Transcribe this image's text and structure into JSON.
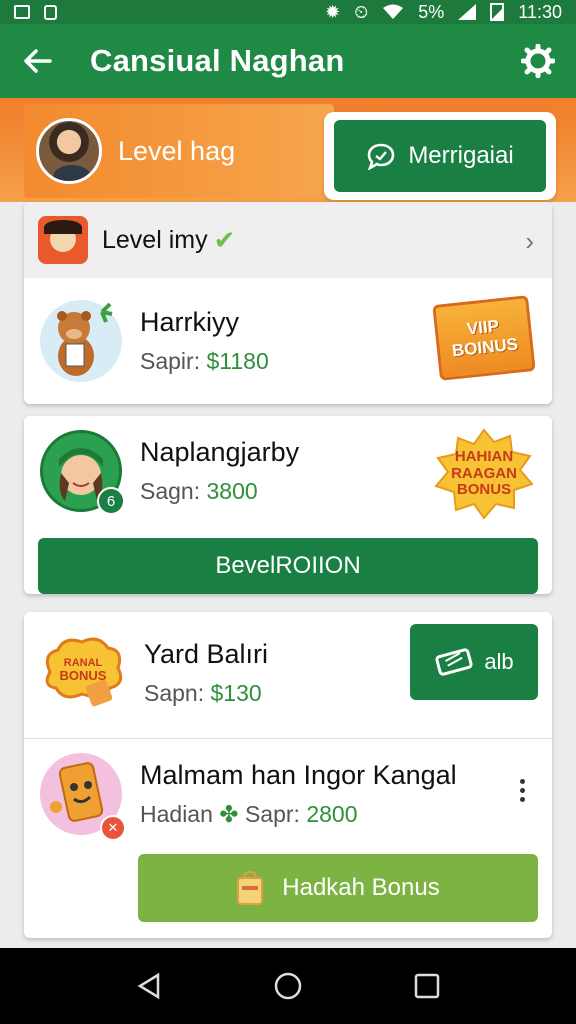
{
  "status_bar": {
    "battery": "5%",
    "time": "11:30"
  },
  "app_bar": {
    "title": "Cansiual Naghan"
  },
  "level_header": {
    "label": "Level hag",
    "messaging_label": "Merrigaiai"
  },
  "level_row": {
    "label": "Level imy"
  },
  "items": [
    {
      "name": "Harrkiyy",
      "price_prefix": "Sapir:",
      "price": "$1180",
      "badge": [
        "VIIP",
        "BOINUS"
      ]
    },
    {
      "name": "Naplangjarby",
      "price_prefix": "Sagn:",
      "price": "3800",
      "badge": [
        "HAHIAN",
        "RAAGAN",
        "BONUS"
      ],
      "avatar_badge": "6",
      "button_label": "BevelROIION"
    },
    {
      "name": "Yard Balıri",
      "price_prefix": "Sapn:",
      "price": "$130",
      "badge": [
        "RANAL",
        "BONUS"
      ],
      "button_label": "alb"
    },
    {
      "name": "Malmam han Ingor Kangal",
      "price_prefix": "Hadian",
      "price_mid": "Sapr:",
      "price": "2800",
      "button_label": "Hadkah Bonus"
    }
  ],
  "colors": {
    "primary": "#1f8a45",
    "orange": "#f07d2a",
    "lime_button": "#7cb342"
  }
}
